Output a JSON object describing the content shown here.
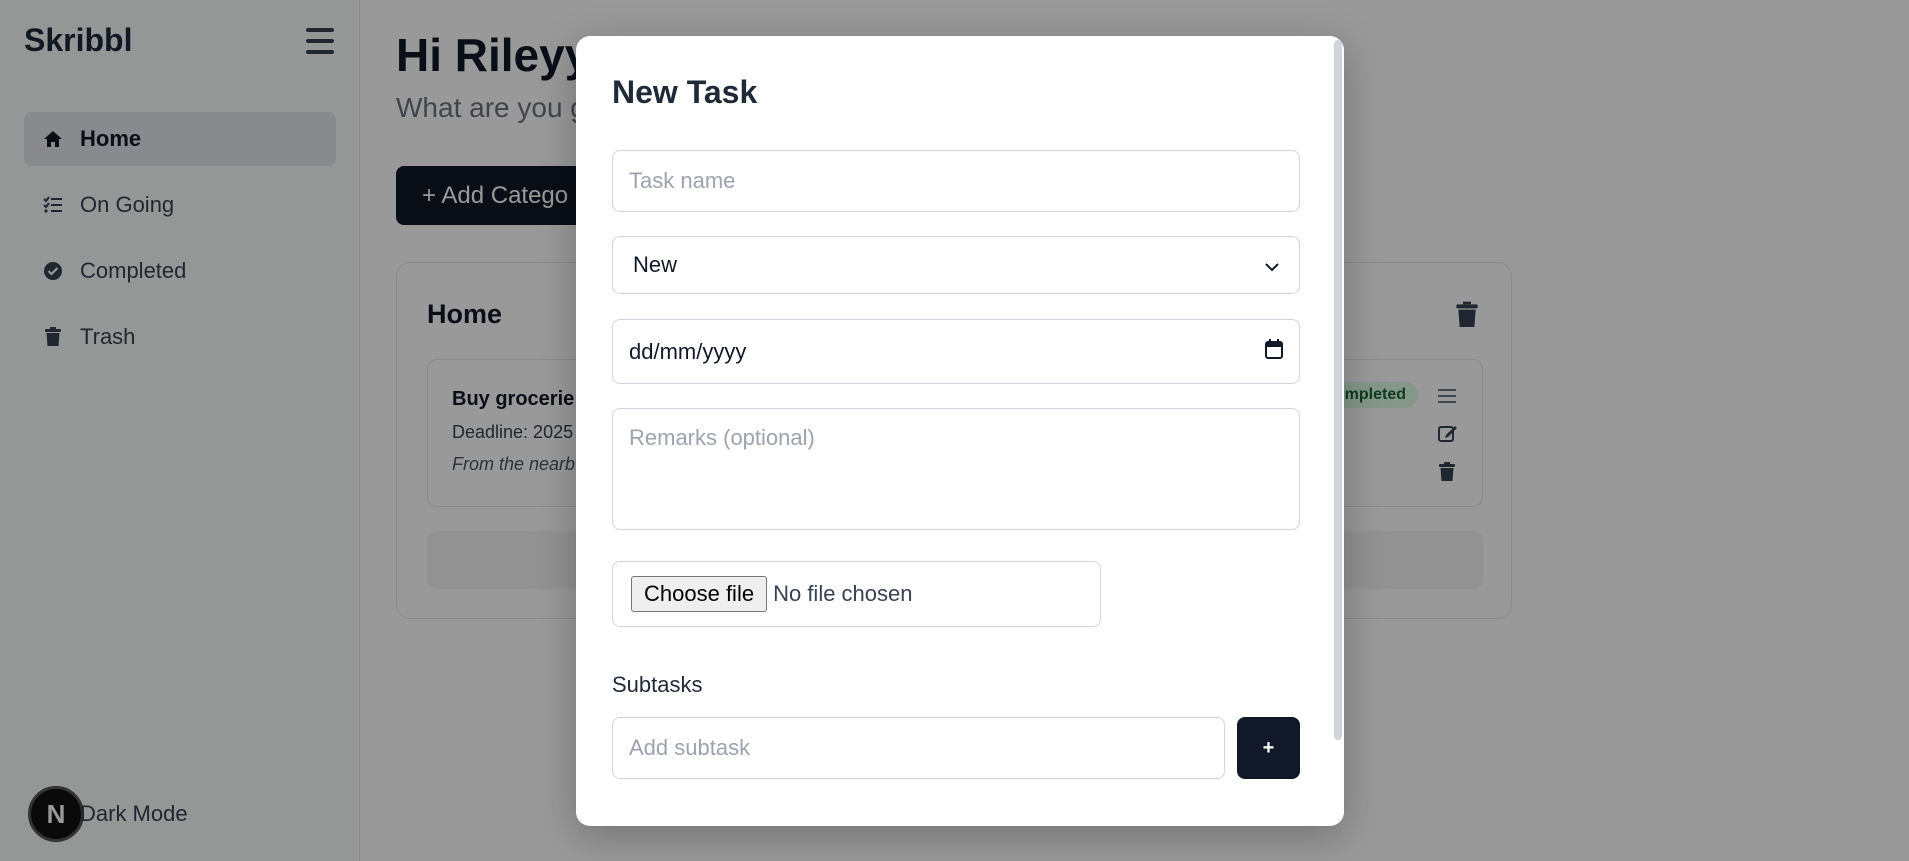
{
  "app": {
    "brand": "Skribbl"
  },
  "sidebar": {
    "items": [
      {
        "label": "Home",
        "icon": "home-icon",
        "active": true
      },
      {
        "label": "On Going",
        "icon": "list-check-icon",
        "active": false
      },
      {
        "label": "Completed",
        "icon": "check-circle-icon",
        "active": false
      },
      {
        "label": "Trash",
        "icon": "trash-icon",
        "active": false
      }
    ],
    "dark_mode_label": "Dark Mode",
    "dark_mode_badge": "N"
  },
  "main": {
    "greeting": "Hi Rileyy",
    "subgreeting": "What are you g",
    "add_category_label": "+ Add Catego",
    "category": {
      "title": "Home",
      "task": {
        "name": "Buy grocerie",
        "deadline": "Deadline: 2025",
        "remark": "From the nearb",
        "status": "mpleted"
      }
    }
  },
  "modal": {
    "title": "New Task",
    "task_name_placeholder": "Task name",
    "status_value": "New",
    "date_value": "dd/mm/yyyy",
    "remarks_placeholder": "Remarks (optional)",
    "file_button_label": "Choose file",
    "file_status": "No file chosen",
    "subtasks_label": "Subtasks",
    "subtask_placeholder": "Add subtask",
    "subtask_add_label": "+"
  },
  "colors": {
    "accent": "#111827",
    "overlay": "rgba(0,0,0,0.4)",
    "status_completed_bg": "#dcfce7",
    "status_completed_text": "#166534"
  }
}
